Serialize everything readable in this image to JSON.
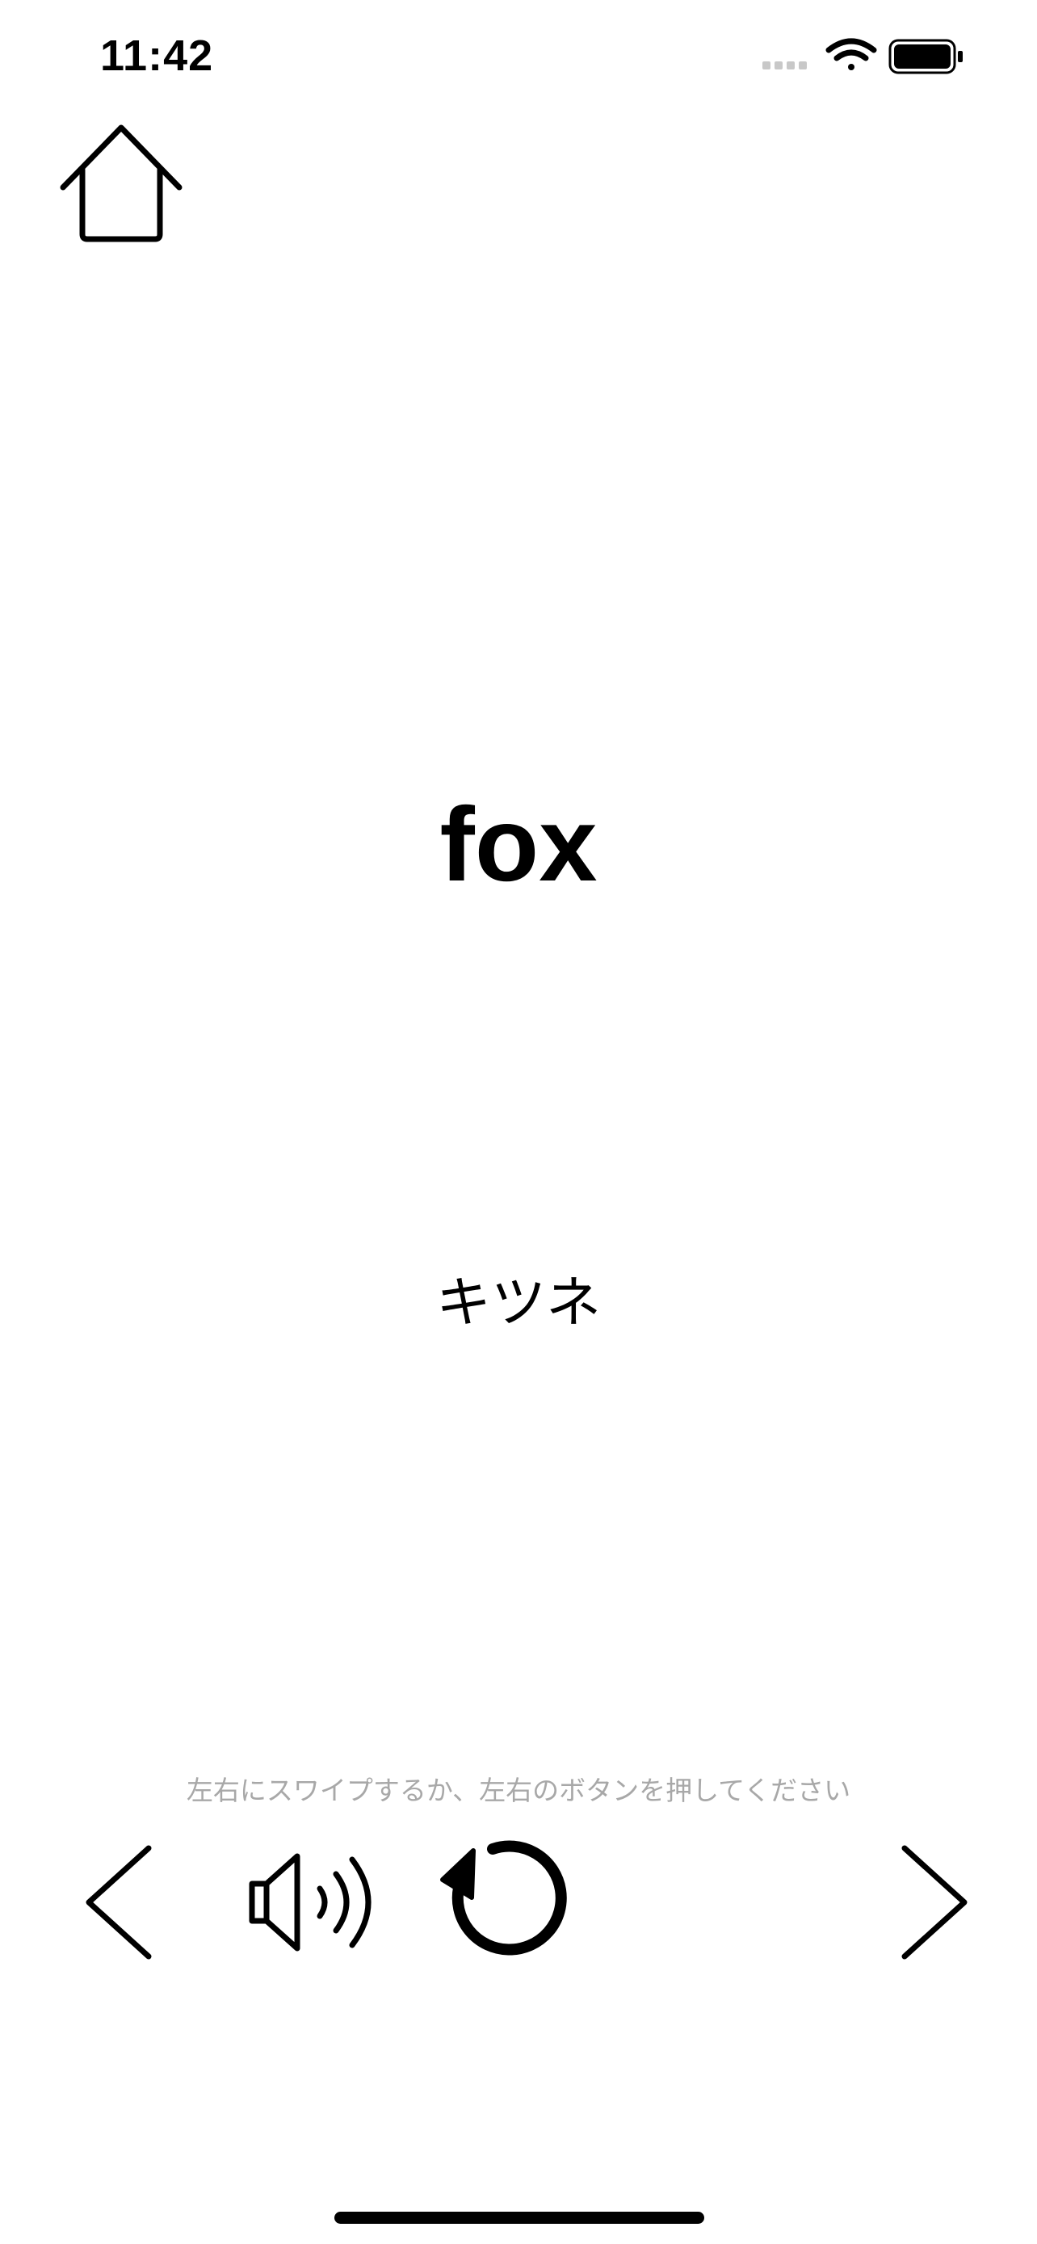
{
  "status_bar": {
    "time": "11:42",
    "icons": [
      "cellular-icon",
      "wifi-icon",
      "battery-icon"
    ]
  },
  "nav": {
    "home_icon": "home-icon"
  },
  "card": {
    "word": "fox",
    "meaning": "キツネ"
  },
  "hint": "左右にスワイプするか、左右のボタンを押してください",
  "controls": {
    "prev_icon": "chevron-left-icon",
    "speaker_icon": "speaker-icon",
    "replay_icon": "replay-icon",
    "next_icon": "chevron-right-icon"
  },
  "colors": {
    "foreground": "#000000",
    "background": "#ffffff",
    "hint_text": "#a8a8a8",
    "inactive_signal": "#c8c8c8"
  }
}
